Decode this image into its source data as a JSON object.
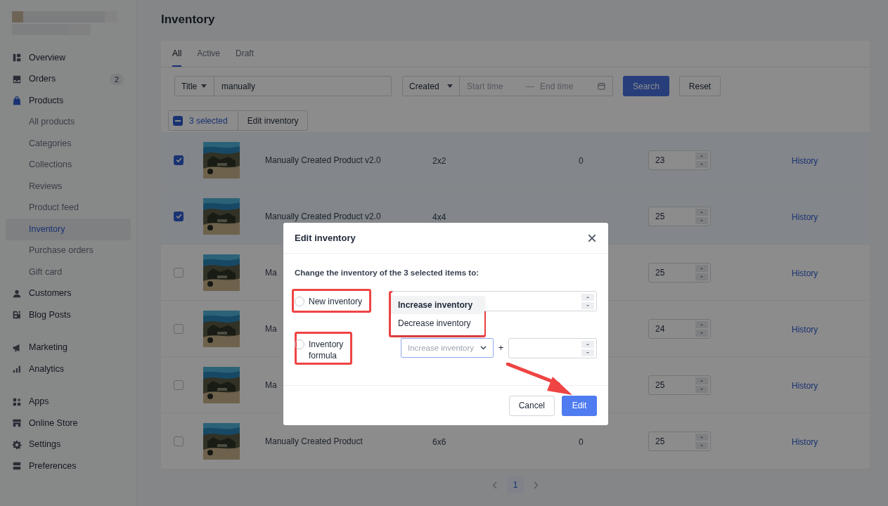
{
  "sidebar": {
    "groups": [
      [
        {
          "label": "Overview",
          "kind": "overview",
          "selected": false
        },
        {
          "label": "Orders",
          "kind": "orders",
          "selected": false,
          "badge": "2"
        },
        {
          "label": "Products",
          "kind": "products",
          "selected": false,
          "children": [
            {
              "label": "All products",
              "selected": false
            },
            {
              "label": "Categories",
              "selected": false
            },
            {
              "label": "Collections",
              "selected": false
            },
            {
              "label": "Reviews",
              "selected": false
            },
            {
              "label": "Product feed",
              "selected": false
            },
            {
              "label": "Inventory",
              "selected": true
            },
            {
              "label": "Purchase orders",
              "selected": false
            },
            {
              "label": "Gift card",
              "selected": false
            }
          ]
        },
        {
          "label": "Customers",
          "kind": "customers",
          "selected": false
        },
        {
          "label": "Blog Posts",
          "kind": "blog",
          "selected": false
        }
      ],
      [
        {
          "label": "Marketing",
          "kind": "marketing",
          "selected": false
        },
        {
          "label": "Analytics",
          "kind": "analytics",
          "selected": false
        }
      ],
      [
        {
          "label": "Apps",
          "kind": "apps",
          "selected": false
        },
        {
          "label": "Online Store",
          "kind": "store",
          "selected": false
        },
        {
          "label": "Settings",
          "kind": "settings",
          "selected": false
        },
        {
          "label": "Preferences",
          "kind": "preferences",
          "selected": false
        }
      ]
    ]
  },
  "page_title": "Inventory",
  "tabs": [
    {
      "label": "All",
      "selected": true
    },
    {
      "label": "Active",
      "selected": false
    },
    {
      "label": "Draft",
      "selected": false
    }
  ],
  "filters": {
    "field_select": "Title",
    "search_value": "manually",
    "date_select": "Created",
    "start_placeholder": "Start time",
    "separator": "—",
    "end_placeholder": "End time",
    "search_button": "Search",
    "reset_button": "Reset"
  },
  "selection_bar": {
    "indeterminate": true,
    "count_label": "3 selected",
    "action": "Edit inventory"
  },
  "table": {
    "rows": [
      {
        "checked": true,
        "name": "Manually Created Product v2.0",
        "variant": "2x2",
        "stock": "0",
        "quantity": "23",
        "link": "History"
      },
      {
        "checked": true,
        "name": "Manually Created Product v2.0",
        "variant": "4x4",
        "quantity": "25",
        "link": "History"
      },
      {
        "checked": false,
        "name": "Ma",
        "quantity": "25",
        "link": "History"
      },
      {
        "checked": false,
        "name": "Ma",
        "quantity": "24",
        "link": "History"
      },
      {
        "checked": false,
        "name": "Ma",
        "quantity": "25",
        "link": "History"
      },
      {
        "checked": false,
        "name": "Manually Created Product",
        "variant": "6x6",
        "stock": "0",
        "quantity": "25",
        "link": "History"
      }
    ]
  },
  "pagination": {
    "pages": [
      {
        "label": "1",
        "selected": true
      }
    ]
  },
  "dialog": {
    "title": "Edit inventory",
    "close": "×",
    "prompt": "Change the inventory of the 3 selected items to:",
    "options": [
      {
        "label": "New inventory",
        "checked": false
      },
      {
        "label": "Inventory formula",
        "checked": false
      }
    ],
    "operation_select": {
      "value": "Increase inventory",
      "expanded": true,
      "options": [
        {
          "label": "Increase inventory",
          "selected": true
        },
        {
          "label": "Decrease inventory",
          "selected": false
        }
      ]
    },
    "plus": "+",
    "buttons": [
      {
        "label": "Cancel",
        "kind": "secondary"
      },
      {
        "label": "Edit",
        "kind": "primary"
      }
    ]
  }
}
